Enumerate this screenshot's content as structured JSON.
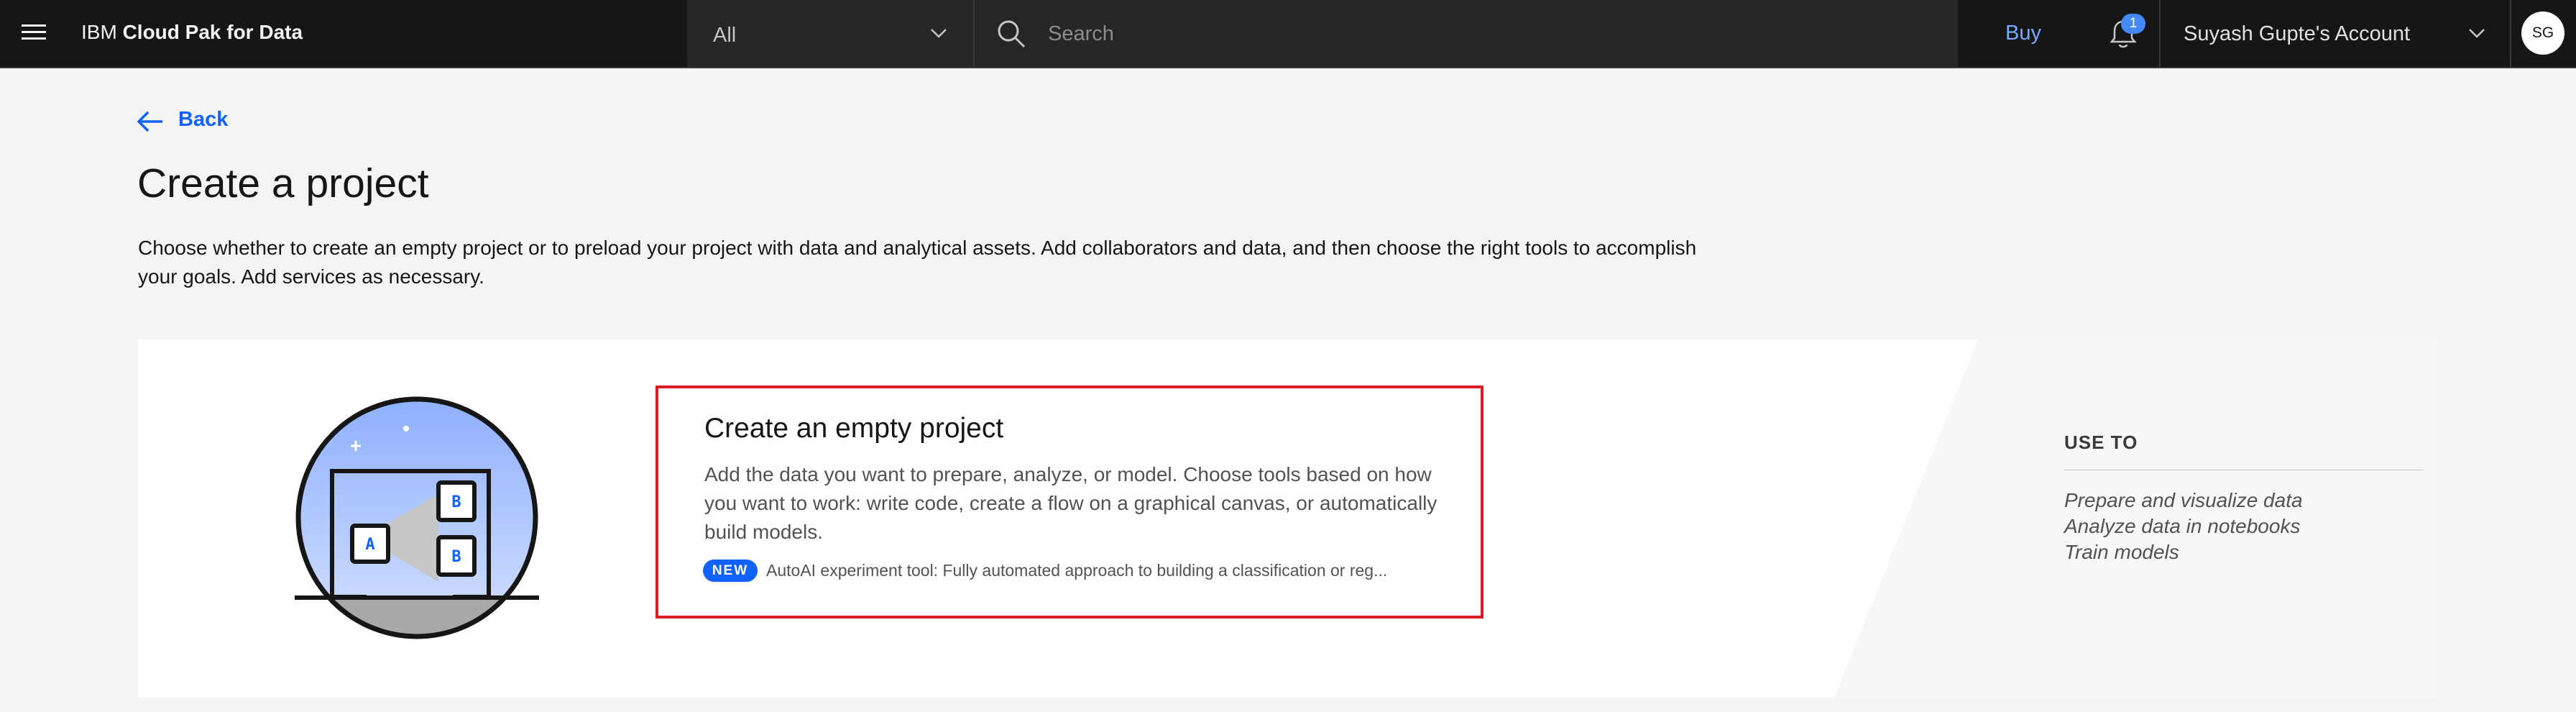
{
  "header": {
    "brand_prefix": "IBM",
    "brand_name": "Cloud Pak for Data",
    "scope_selected": "All",
    "search_placeholder": "Search",
    "buy_label": "Buy",
    "notification_count": "1",
    "account_label": "Suyash Gupte's Account",
    "avatar_initials": "SG"
  },
  "page": {
    "back_label": "Back",
    "title": "Create a project",
    "description": "Choose whether to create an empty project or to preload your project with data and analytical assets. Add collaborators and data, and then choose the right tools to accomplish your goals. Add services as necessary."
  },
  "option": {
    "title": "Create an empty project",
    "description": "Add the data you want to prepare, analyze, or model. Choose tools based on how you want to work: write code, create a flow on a graphical canvas, or automatically build models.",
    "tag": "NEW",
    "tag_text": "AutoAI experiment tool: Fully automated approach to building a classification or reg..."
  },
  "use_to": {
    "title": "USE TO",
    "items": [
      "Prepare and visualize data",
      "Analyze data in notebooks",
      "Train models"
    ]
  },
  "colors": {
    "header_bg": "#161616",
    "accent": "#0f62fe",
    "selection_border": "#da1e28"
  },
  "icons": [
    "menu-icon",
    "chevron-down-icon",
    "search-icon",
    "notification-icon",
    "arrow-left-icon"
  ]
}
